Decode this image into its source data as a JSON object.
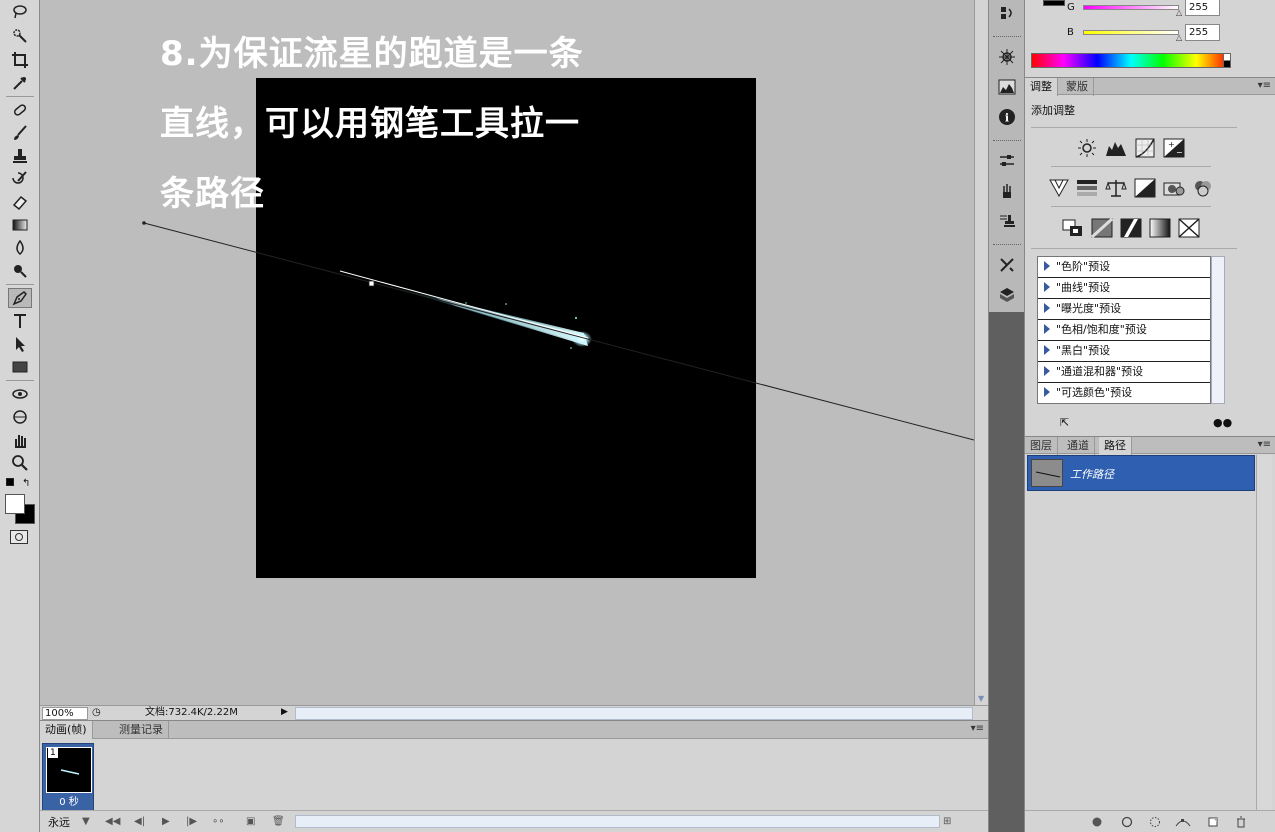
{
  "tutorial": {
    "line1": "8.为保证流星的跑道是一条",
    "line2": "直线，可以用钢笔工具拉一",
    "line3": "条路径"
  },
  "status": {
    "zoom": "100%",
    "doc_info": "文档:732.4K/2.22M"
  },
  "animation_panel": {
    "tabs": [
      "动画(帧)",
      "测量记录"
    ],
    "frame_number": "1",
    "frame_delay": "0 秒",
    "loop": "永远"
  },
  "color_panel": {
    "g_label": "G",
    "g_value": "255",
    "b_label": "B",
    "b_value": "255"
  },
  "adjust_panel": {
    "tabs": [
      "调整",
      "蒙版"
    ],
    "title": "添加调整",
    "presets": [
      "\"色阶\"预设",
      "\"曲线\"预设",
      "\"曝光度\"预设",
      "\"色相/饱和度\"预设",
      "\"黑白\"预设",
      "\"通道混和器\"预设",
      "\"可选颜色\"预设"
    ]
  },
  "paths_panel": {
    "tabs": [
      "图层",
      "通道",
      "路径"
    ],
    "work_path": "工作路径"
  },
  "colors": {
    "selection": "#2f5fb0",
    "canvas_bg": "#bdbdbd",
    "meteor": "#bff6ff"
  }
}
